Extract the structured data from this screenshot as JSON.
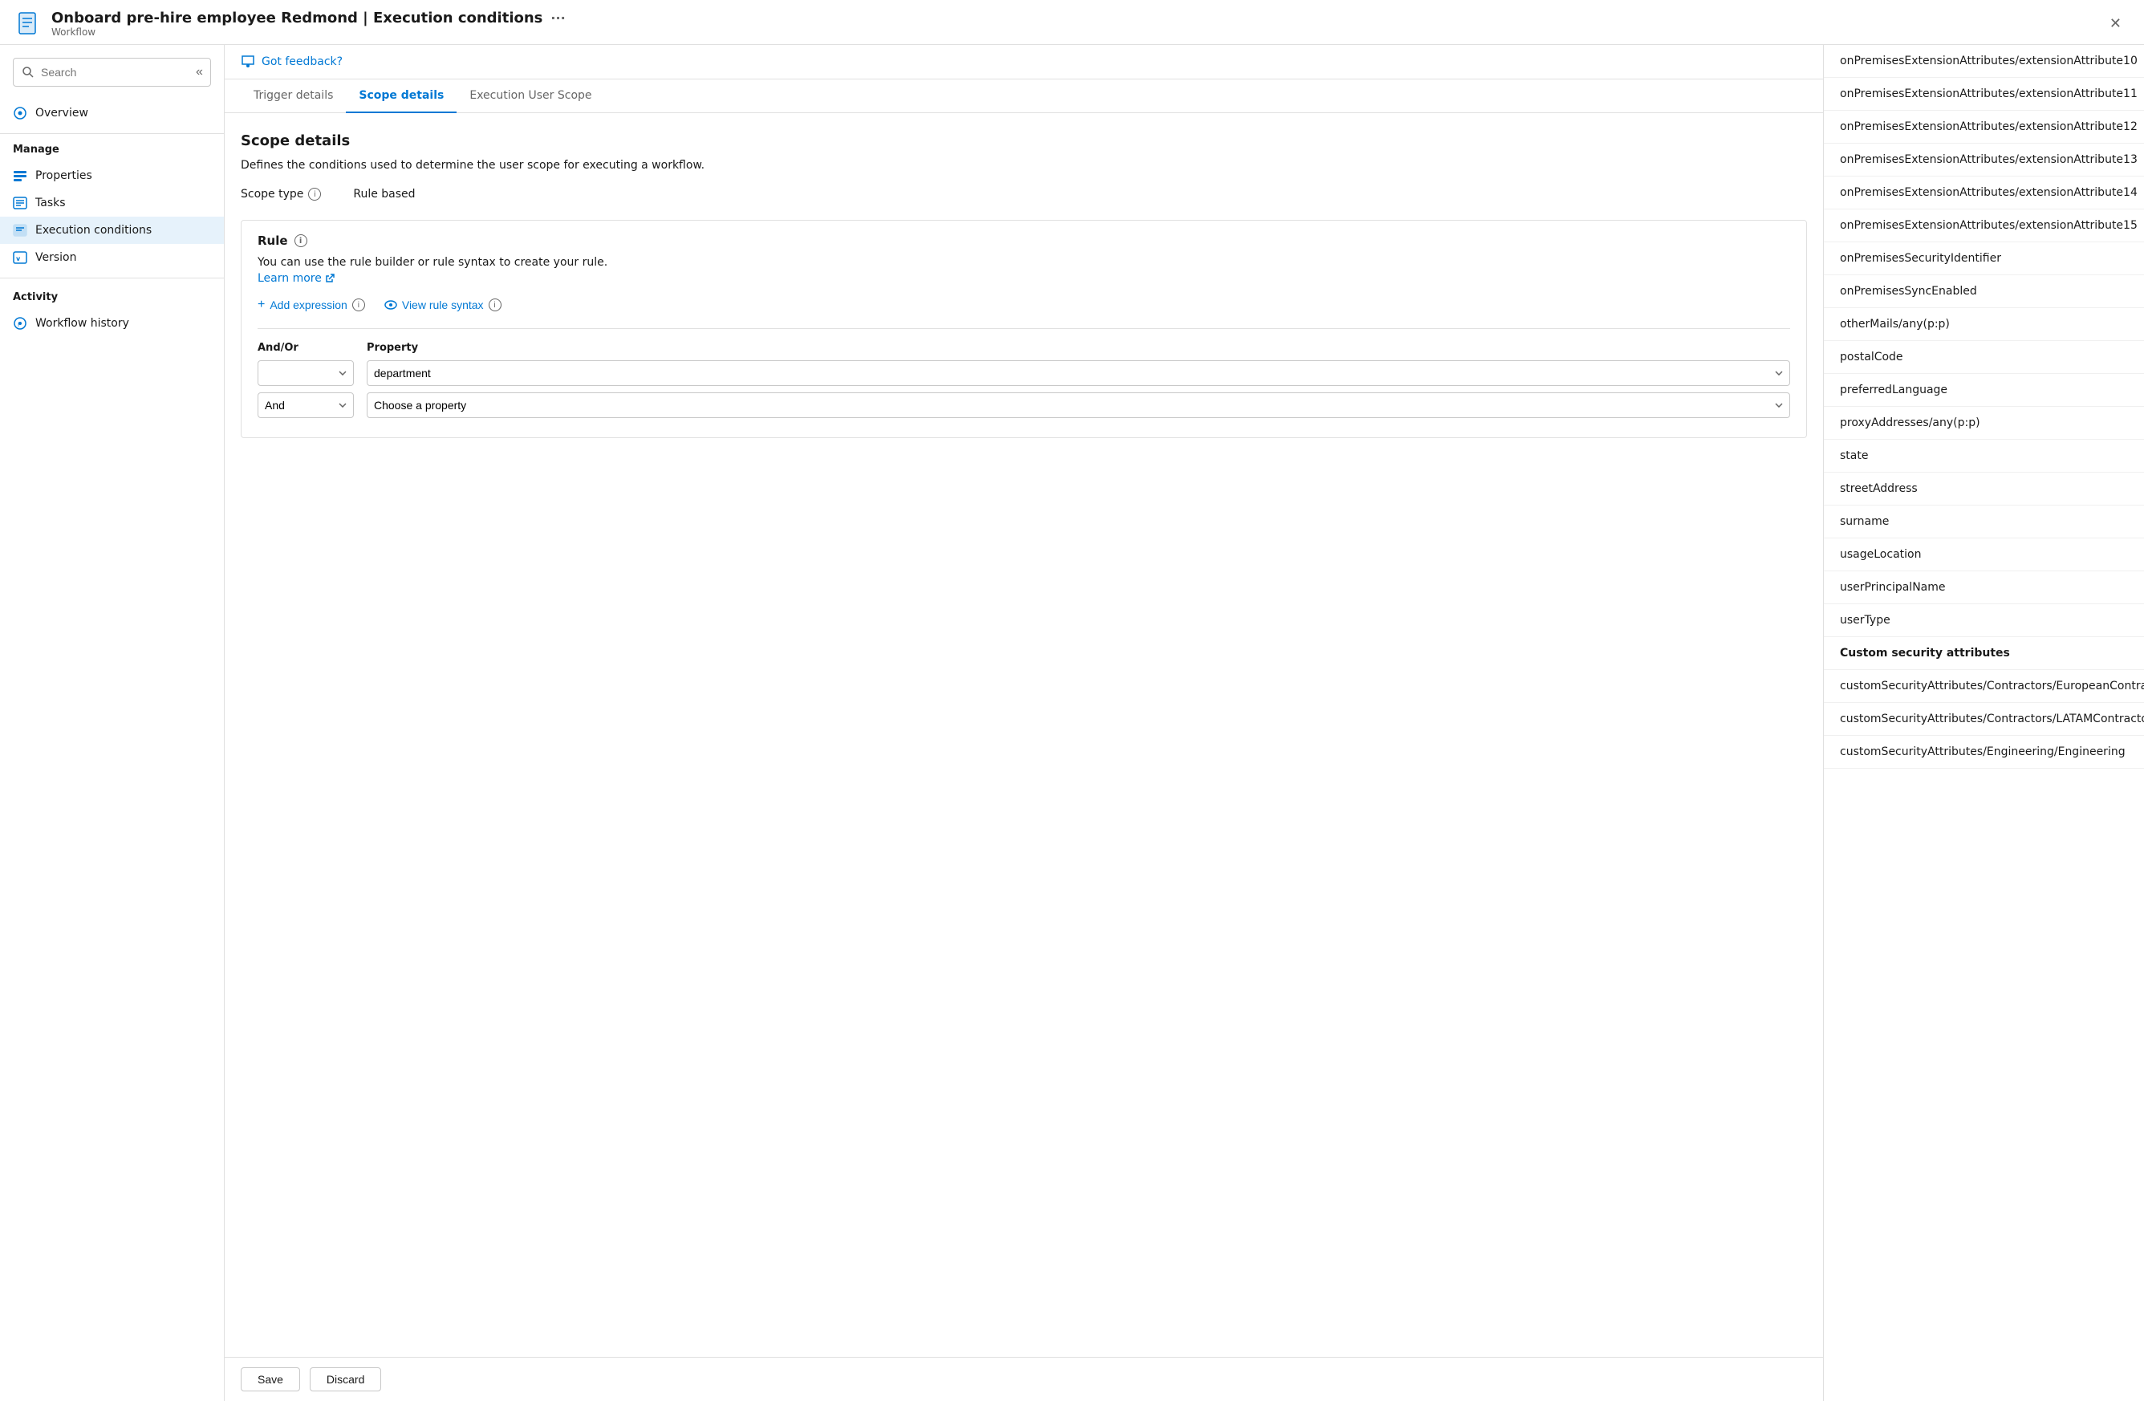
{
  "header": {
    "title": "Onboard pre-hire employee Redmond | Execution conditions",
    "subtitle": "Workflow",
    "dots_label": "···",
    "close_label": "✕"
  },
  "sidebar": {
    "search_placeholder": "Search",
    "collapse_icon": "«",
    "manage_label": "Manage",
    "items": [
      {
        "id": "properties",
        "label": "Properties",
        "icon": "properties"
      },
      {
        "id": "tasks",
        "label": "Tasks",
        "icon": "tasks"
      },
      {
        "id": "execution-conditions",
        "label": "Execution conditions",
        "icon": "execution-conditions",
        "active": true
      }
    ],
    "version_label": "Version",
    "activity_label": "Activity",
    "activity_items": [
      {
        "id": "workflow-history",
        "label": "Workflow history",
        "icon": "history"
      }
    ]
  },
  "feedback": {
    "label": "Got feedback?"
  },
  "tabs": [
    {
      "id": "trigger-details",
      "label": "Trigger details",
      "active": false
    },
    {
      "id": "scope-details",
      "label": "Scope details",
      "active": true
    },
    {
      "id": "execution-user-scope",
      "label": "Execution User Scope",
      "active": false
    }
  ],
  "scope_details": {
    "title": "Scope details",
    "description": "Defines the conditions used to determine the user scope for executing a workflow.",
    "scope_type_label": "Scope type",
    "scope_type_value": "Rule based",
    "rule_title": "Rule",
    "rule_description": "You can use the rule builder or rule syntax to create your rule.",
    "learn_more_label": "Learn more",
    "add_expression_label": "Add expression",
    "view_rule_syntax_label": "View rule syntax",
    "columns": {
      "andor": "And/Or",
      "property": "Property"
    },
    "rows": [
      {
        "andor": "",
        "property": "department",
        "property_placeholder": ""
      },
      {
        "andor": "And",
        "property": "",
        "property_placeholder": "Choose a property"
      }
    ],
    "andor_options": [
      "",
      "And",
      "Or"
    ],
    "save_label": "Save",
    "discard_label": "Discard"
  },
  "dropdown_list": {
    "items": [
      {
        "type": "item",
        "label": "onPremisesExtensionAttributes/extensionAttribute10"
      },
      {
        "type": "item",
        "label": "onPremisesExtensionAttributes/extensionAttribute11"
      },
      {
        "type": "item",
        "label": "onPremisesExtensionAttributes/extensionAttribute12"
      },
      {
        "type": "item",
        "label": "onPremisesExtensionAttributes/extensionAttribute13"
      },
      {
        "type": "item",
        "label": "onPremisesExtensionAttributes/extensionAttribute14"
      },
      {
        "type": "item",
        "label": "onPremisesExtensionAttributes/extensionAttribute15"
      },
      {
        "type": "item",
        "label": "onPremisesSecurity​Identifier"
      },
      {
        "type": "item",
        "label": "onPremisesSyncEnabled"
      },
      {
        "type": "item",
        "label": "otherMails/any(p:p)"
      },
      {
        "type": "item",
        "label": "postalCode"
      },
      {
        "type": "item",
        "label": "preferredLanguage"
      },
      {
        "type": "item",
        "label": "proxyAddresses/any(p:p)"
      },
      {
        "type": "item",
        "label": "state"
      },
      {
        "type": "item",
        "label": "streetAddress"
      },
      {
        "type": "item",
        "label": "surname"
      },
      {
        "type": "item",
        "label": "usageLocation"
      },
      {
        "type": "item",
        "label": "userPrincipalName"
      },
      {
        "type": "item",
        "label": "userType"
      },
      {
        "type": "section-header",
        "label": "Custom security attributes"
      },
      {
        "type": "item",
        "label": "customSecurityAttributes/Contractors/EuropeanContractors"
      },
      {
        "type": "item",
        "label": "customSecurityAttributes/Contractors/LATAMContractors"
      },
      {
        "type": "item",
        "label": "customSecurityAttributes/Engineering/Engineering"
      }
    ]
  }
}
